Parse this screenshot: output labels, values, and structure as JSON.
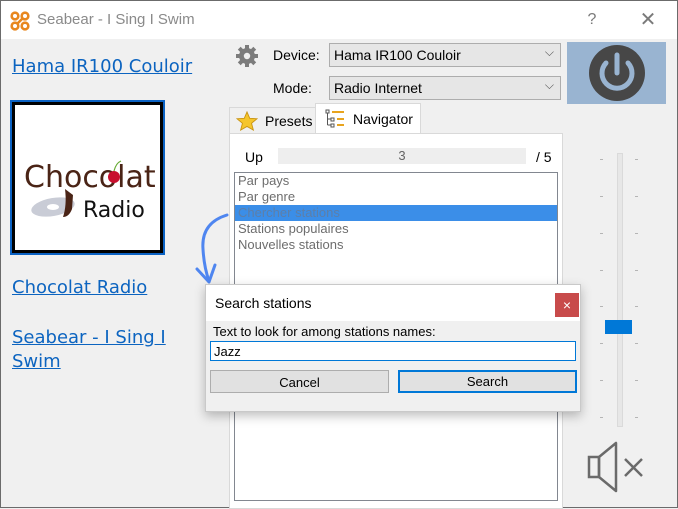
{
  "window": {
    "title": "Seabear - I Sing I Swim",
    "help_label": "?",
    "close_label": "✕"
  },
  "left": {
    "device_link": "Hama IR100 Couloir",
    "station_link": "Chocolat Radio",
    "track_link": "Seabear - I Sing I Swim",
    "logo": {
      "word1": "Chocolat",
      "word2": "Radio"
    }
  },
  "controls": {
    "device_label": "Device:",
    "device_value": "Hama IR100 Couloir",
    "mode_label": "Mode:",
    "mode_value": "Radio Internet",
    "chevron": "⌵"
  },
  "tabs": [
    {
      "label": "Presets",
      "icon": "star-icon",
      "active": false
    },
    {
      "label": "Navigator",
      "icon": "tree-icon",
      "active": true
    }
  ],
  "navigator": {
    "up_label": "Up",
    "level": "3",
    "total": "/ 5",
    "items": [
      {
        "label": "Par pays",
        "selected": false
      },
      {
        "label": "Par genre",
        "selected": false
      },
      {
        "label": "Chercher stations",
        "selected": true
      },
      {
        "label": "Stations populaires",
        "selected": false
      },
      {
        "label": "Nouvelles stations",
        "selected": false
      }
    ]
  },
  "volume": {
    "level_percent": 35,
    "muted": true
  },
  "dialog": {
    "title": "Search stations",
    "close_label": "×",
    "prompt": "Text to look for among stations names:",
    "input_value": "Jazz",
    "cancel_label": "Cancel",
    "search_label": "Search"
  },
  "colors": {
    "accent": "#0078d7",
    "link": "#0c64c0",
    "selection": "#3b8ee8",
    "power_bg": "#99b4d1",
    "dialog_close": "#c84b4b",
    "app_icon": "#e8871e"
  }
}
